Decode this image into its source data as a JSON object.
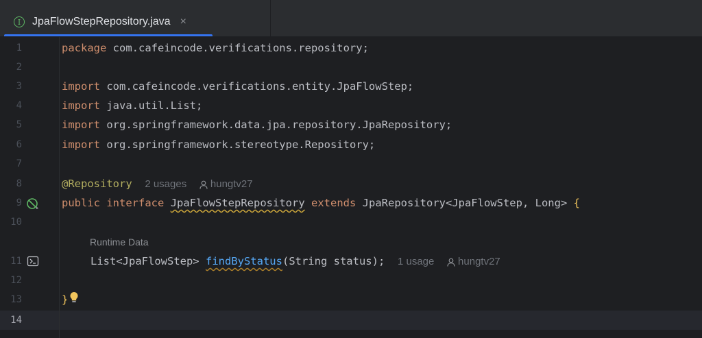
{
  "tab": {
    "icon": "interface-icon",
    "icon_letter": "I",
    "filename": "JpaFlowStepRepository.java",
    "close": "×"
  },
  "gutter": {
    "line_numbers": [
      "1",
      "2",
      "3",
      "4",
      "5",
      "6",
      "7",
      "8",
      "9",
      "10",
      "11",
      "12",
      "13",
      "14"
    ],
    "current_line": "14"
  },
  "code": {
    "l1": {
      "kw": "package",
      "text": " com.cafeincode.verifications.repository;"
    },
    "l3": {
      "kw": "import",
      "text": " com.cafeincode.verifications.entity.JpaFlowStep;"
    },
    "l4": {
      "kw": "import",
      "text": " java.util.List;"
    },
    "l5": {
      "kw": "import",
      "text": " org.springframework.data.jpa.repository.JpaRepository;"
    },
    "l6": {
      "kw": "import",
      "text": " org.springframework.stereotype.Repository;"
    },
    "l8": {
      "annotation": "@Repository",
      "usages": "2 usages",
      "author": "hungtv27"
    },
    "l9": {
      "kw1": "public",
      "kw2": "interface",
      "name": "JpaFlowStepRepository",
      "kw3": "extends",
      "rest": "JpaRepository<JpaFlowStep, Long>",
      "brace": "{"
    },
    "hint_label": "Runtime Data",
    "l11": {
      "type": "List<JpaFlowStep>",
      "method": "findByStatus",
      "params_open": "(",
      "ptype": "String",
      "pname": " status",
      "params_close": ");",
      "usages": "1 usage",
      "author": "hungtv27"
    },
    "l13": {
      "brace": "}"
    }
  }
}
